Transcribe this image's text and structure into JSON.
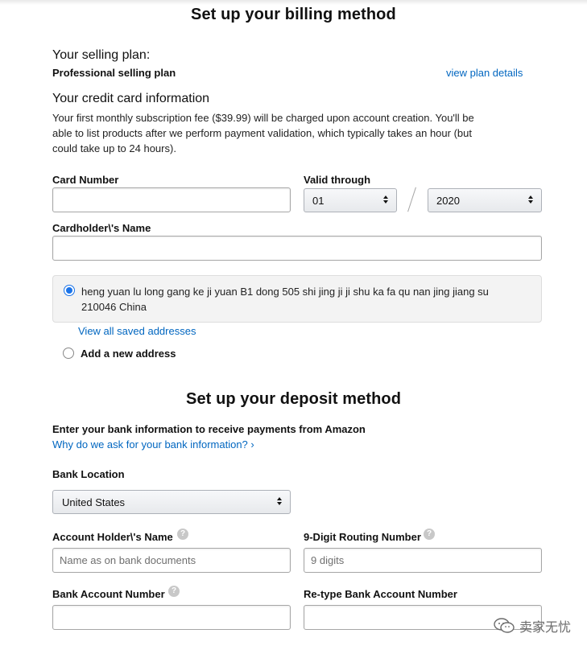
{
  "billing": {
    "title": "Set up your billing method",
    "plan_heading": "Your selling plan:",
    "plan_name": "Professional selling plan",
    "view_plan_link": "view plan details",
    "cc_heading": "Your credit card information",
    "cc_note_1": "Your first monthly subscription fee ($39.99) will be charged upon account creation. You'll be",
    "cc_note_2": "able to list products after we perform payment validation, which typically takes an hour (but",
    "cc_note_3": "could take up to 24 hours).",
    "card_number_label": "Card Number",
    "card_number_value": "",
    "valid_through_label": "Valid through",
    "month_value": "01",
    "year_value": "2020",
    "cardholder_label": "Cardholder\\'s Name",
    "cardholder_value": "",
    "address_line1": "heng yuan lu long gang ke ji yuan B1 dong 505 shi jing ji ji shu ka fa qu nan jing jiang su",
    "address_line2": "210046 China",
    "view_saved_link": "View all saved addresses",
    "add_new_address": "Add a new address"
  },
  "deposit": {
    "title": "Set up your deposit method",
    "bank_info_heading": "Enter your bank information to receive payments from Amazon",
    "why_link": "Why do we ask for your bank information? ›",
    "bank_location_label": "Bank Location",
    "bank_location_value": "United States",
    "holder_name_label": "Account Holder\\'s Name",
    "holder_name_placeholder": "Name as on bank documents",
    "routing_label": "9-Digit Routing Number",
    "routing_placeholder": "9 digits",
    "account_number_label": "Bank Account Number",
    "retype_account_label": "Re-type Bank Account Number"
  },
  "icons": {
    "help": "help-question-icon",
    "selected_radio": "radio-selected-icon",
    "watermark_logo": "wechat-logo-icon"
  },
  "colors": {
    "link": "#0066c0",
    "radio_accent": "#1a73e8"
  },
  "watermark": {
    "text": "卖家无忧"
  }
}
